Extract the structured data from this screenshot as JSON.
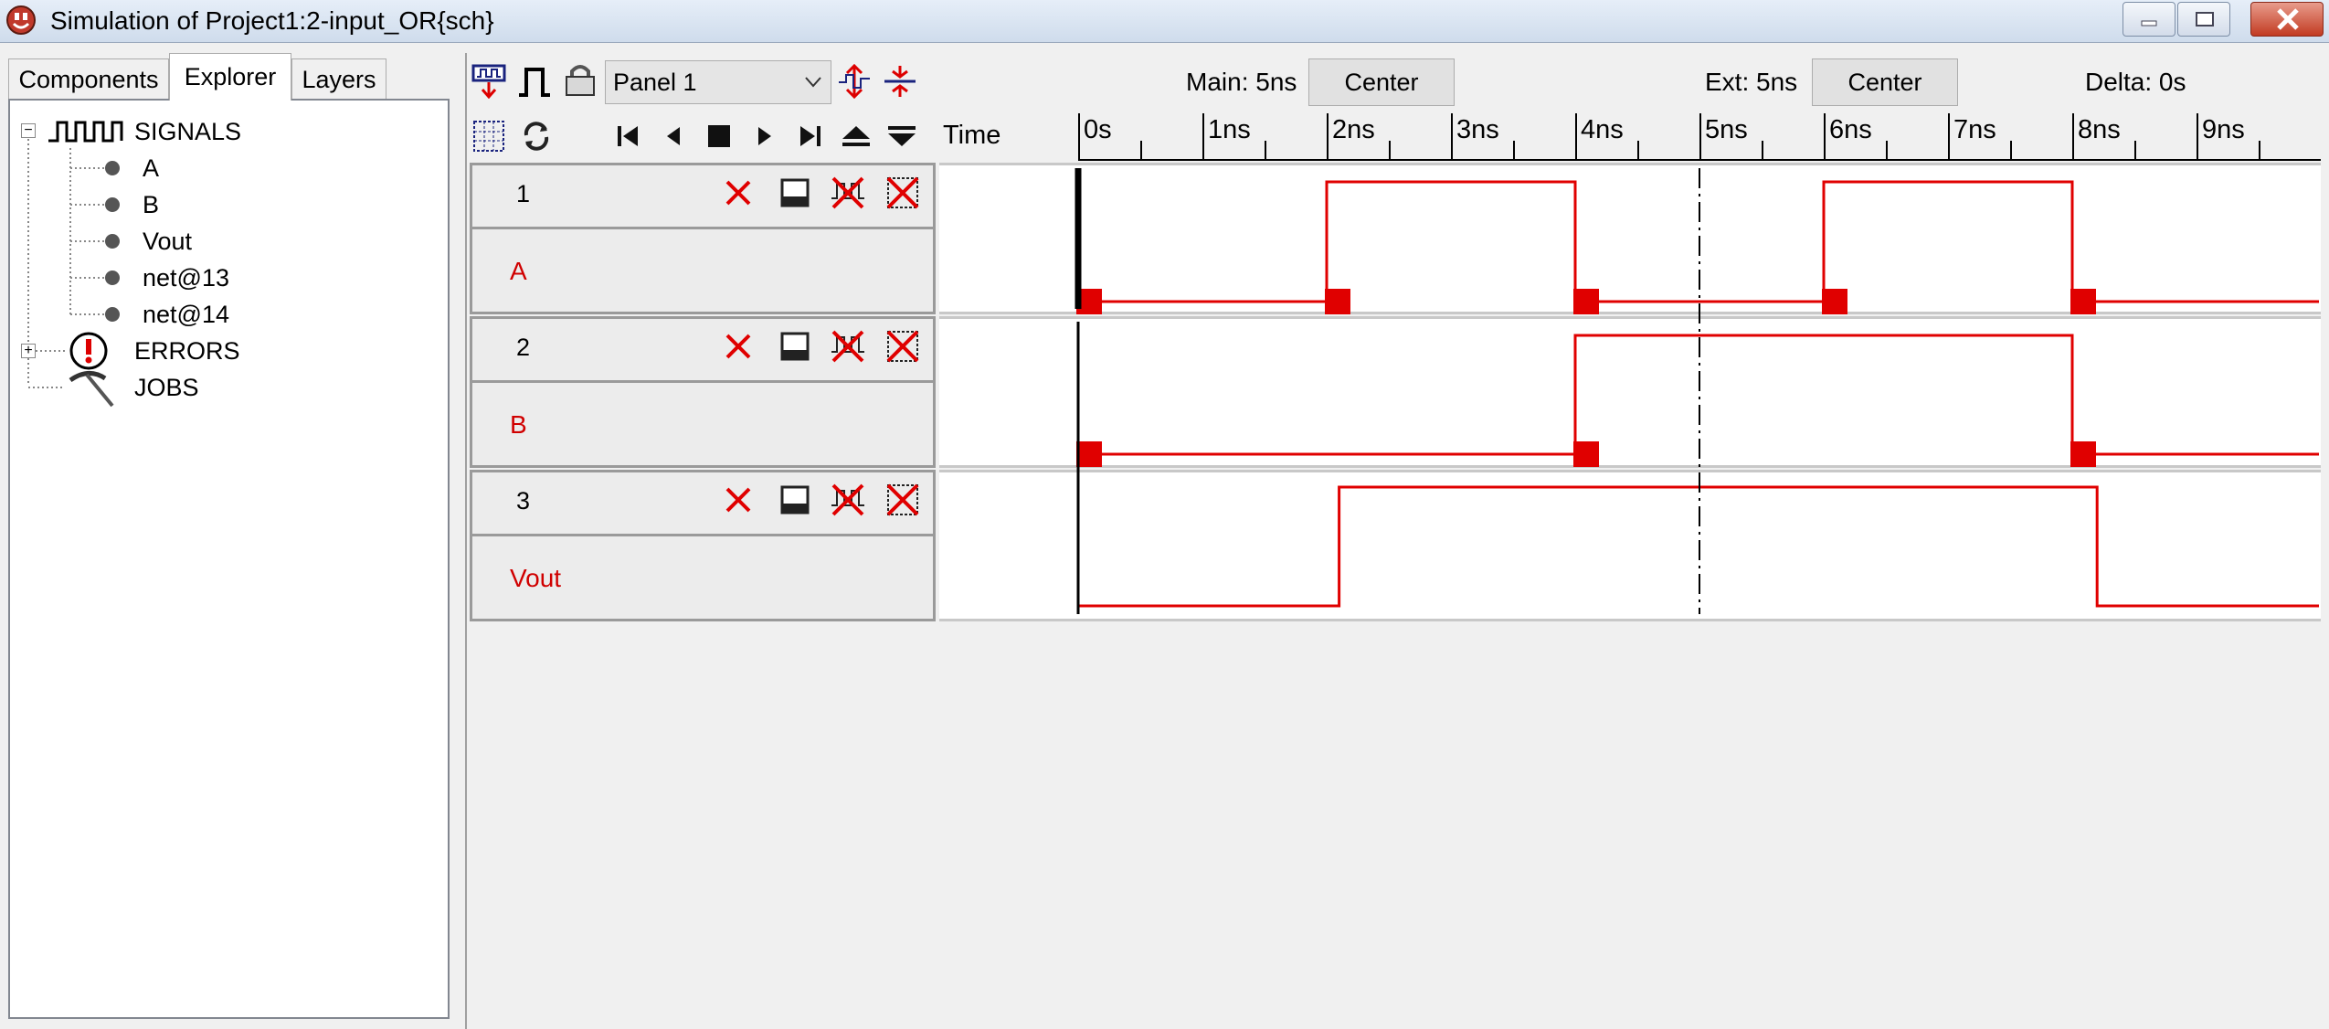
{
  "window": {
    "title": "Simulation of Project1:2-input_OR{sch}"
  },
  "left_panel": {
    "tabs": [
      "Components",
      "Explorer",
      "Layers"
    ],
    "tree": {
      "signals_label": "SIGNALS",
      "signals": [
        "A",
        "B",
        "Vout",
        "net@13",
        "net@14"
      ],
      "errors_label": "ERRORS",
      "jobs_label": "JOBS"
    }
  },
  "toolbar": {
    "panel_select": "Panel 1",
    "main_label": "Main: 5ns",
    "main_center": "Center",
    "ext_label": "Ext: 5ns",
    "ext_center": "Center",
    "delta_label": "Delta: 0s"
  },
  "ruler": {
    "time_label": "Time",
    "ticks": [
      "0s",
      "1ns",
      "2ns",
      "3ns",
      "4ns",
      "5ns",
      "6ns",
      "7ns",
      "8ns",
      "9ns"
    ]
  },
  "rows": [
    {
      "number": "1",
      "name": "A"
    },
    {
      "number": "2",
      "name": "B"
    },
    {
      "number": "3",
      "name": "Vout"
    }
  ],
  "colors": {
    "trace": "#e00000",
    "label": "#d00000",
    "cursor_main": "#000000"
  },
  "waveforms": {
    "time_unit": "ns",
    "main_cursor_ns": 0,
    "ext_cursor_ns": 5,
    "A": {
      "transitions": [
        [
          0,
          0
        ],
        [
          2,
          1
        ],
        [
          4,
          0
        ],
        [
          6,
          1
        ],
        [
          8,
          0
        ]
      ]
    },
    "B": {
      "transitions": [
        [
          0,
          0
        ],
        [
          4,
          1
        ],
        [
          8,
          0
        ]
      ]
    },
    "Vout": {
      "transitions": [
        [
          0,
          0
        ],
        [
          2.1,
          1
        ],
        [
          8.2,
          0
        ]
      ]
    }
  }
}
